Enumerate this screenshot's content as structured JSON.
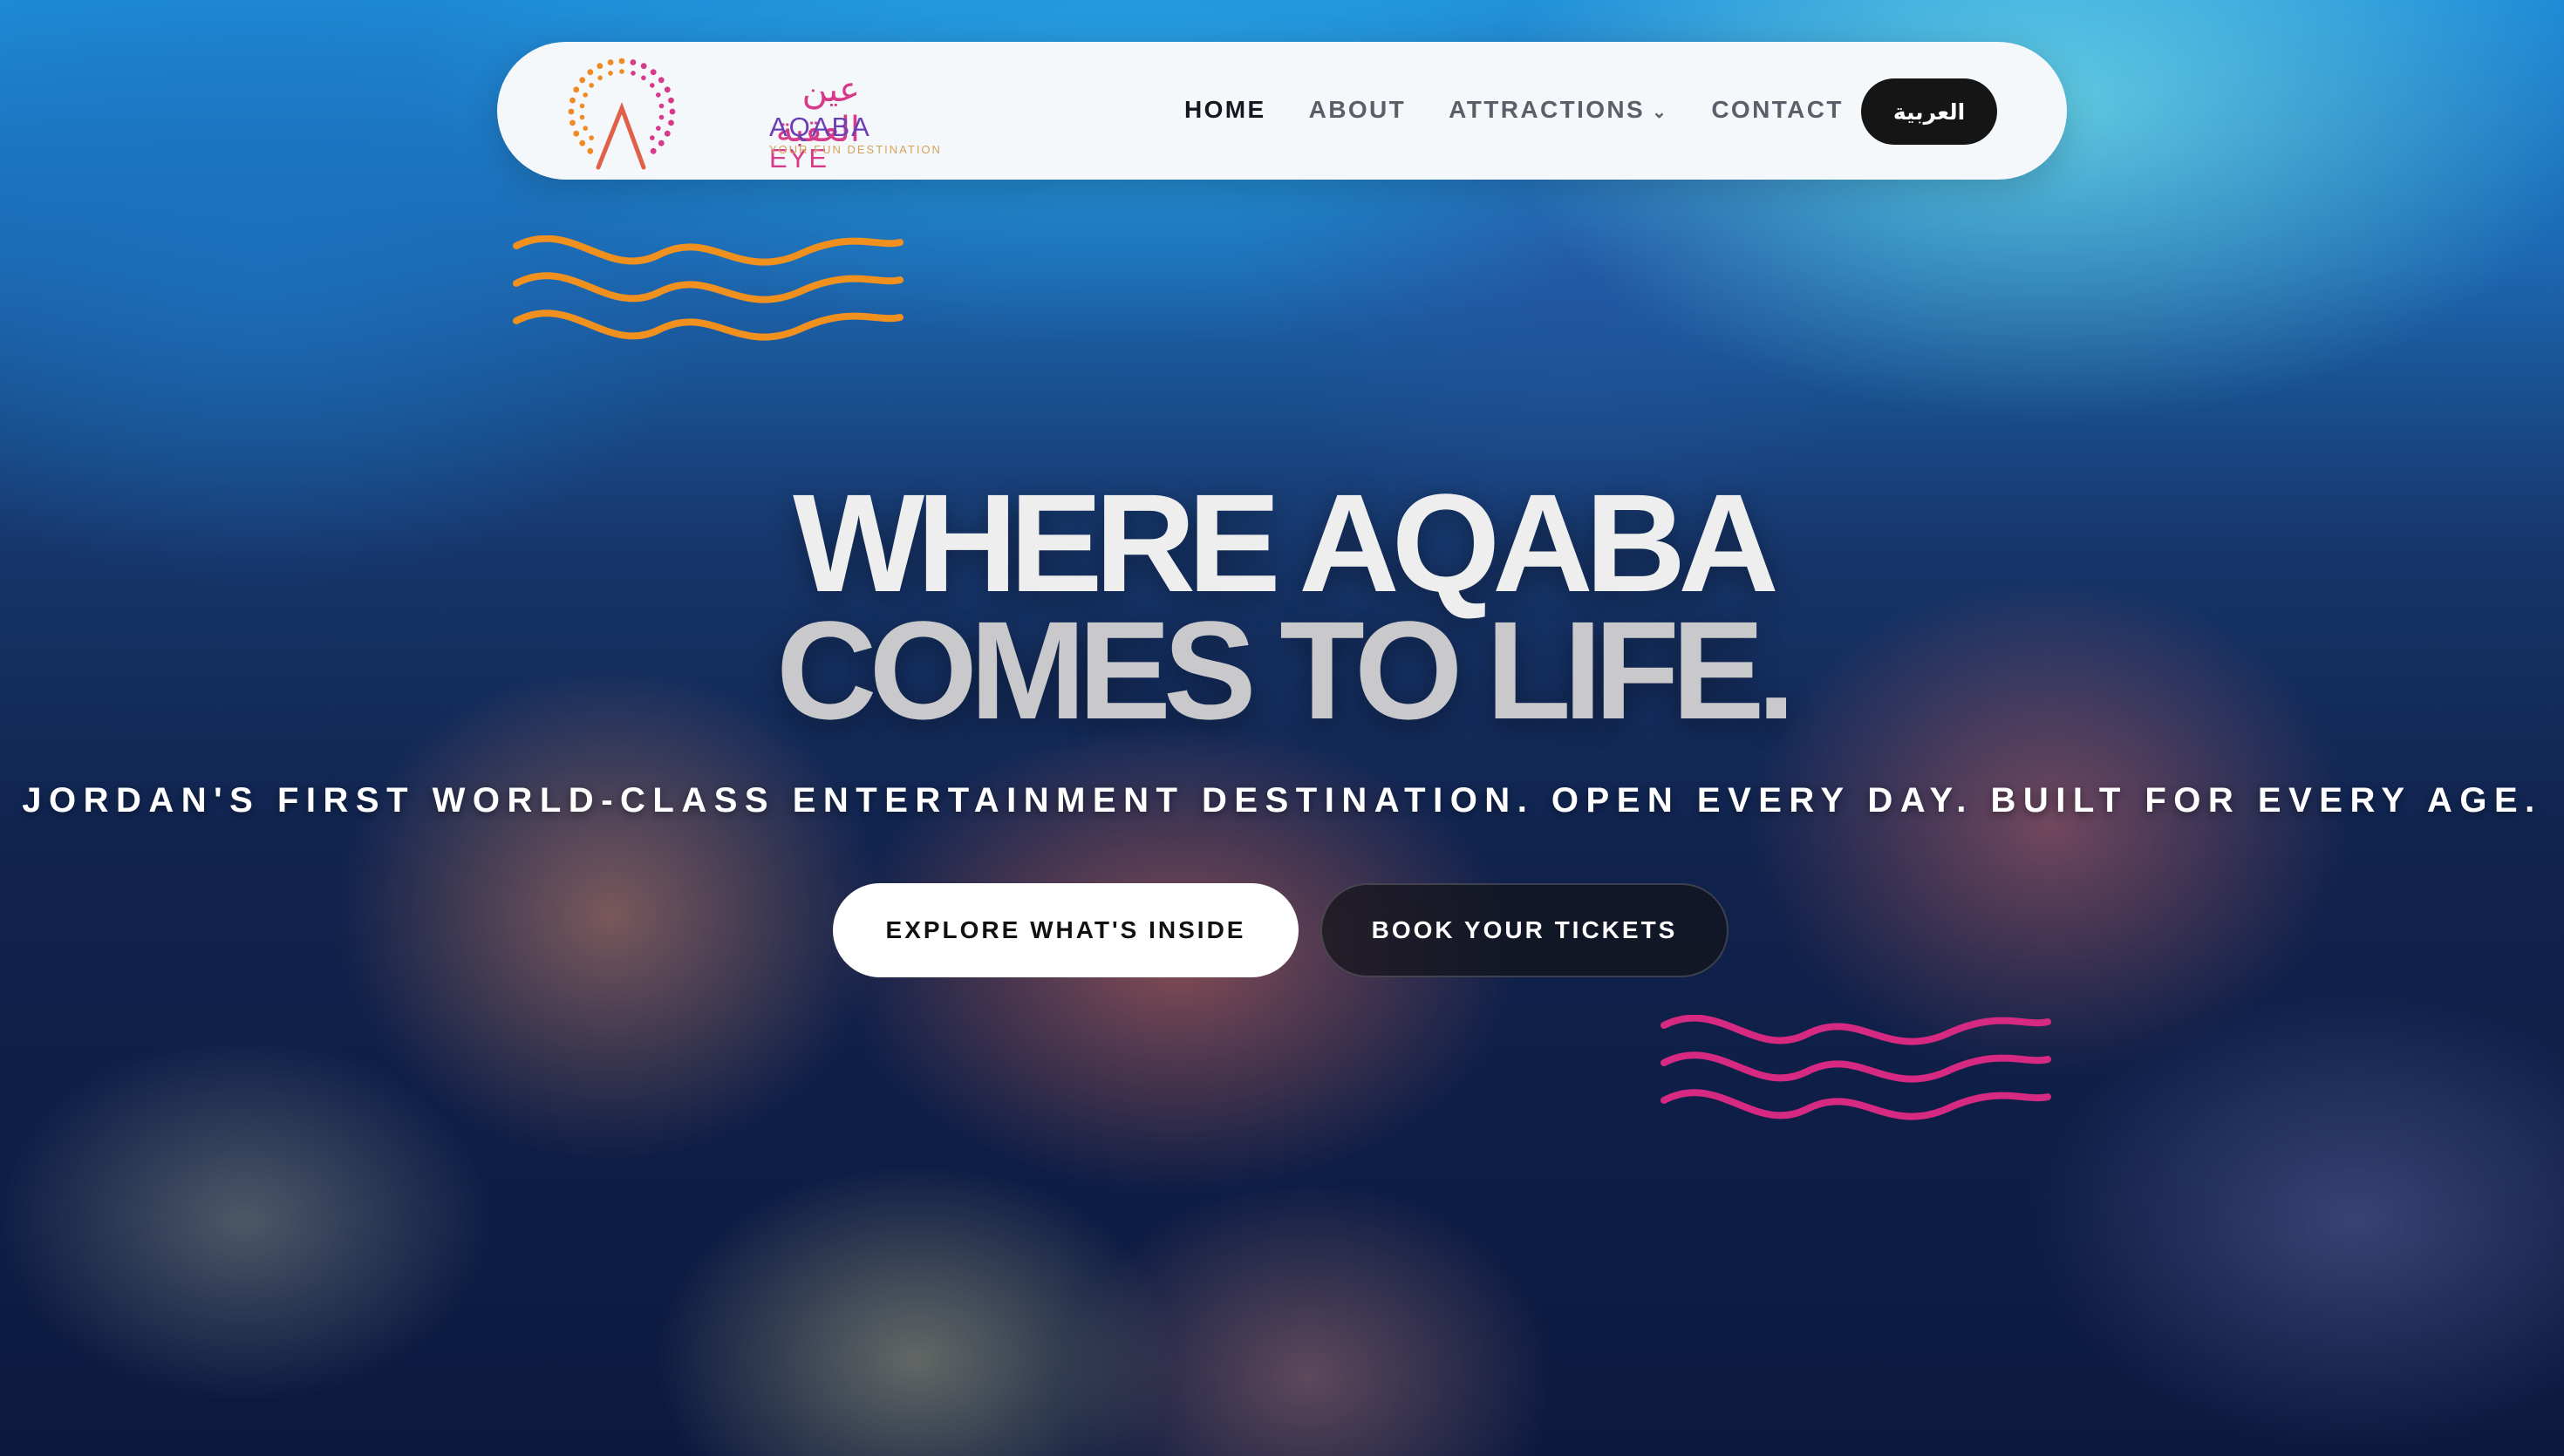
{
  "nav": {
    "logo": {
      "arabic": "عين العقبة",
      "name_part1": "AQABA",
      "name_part2": "EYE",
      "tagline": "YOUR FUN DESTINATION"
    },
    "items": [
      {
        "label": "HOME",
        "active": true
      },
      {
        "label": "ABOUT",
        "active": false
      },
      {
        "label": "ATTRACTIONS",
        "active": false,
        "has_dropdown": true
      },
      {
        "label": "CONTACT",
        "active": false
      }
    ],
    "language_button": "العربية"
  },
  "hero": {
    "headline_line1": "WHERE AQABA",
    "headline_line2": "COMES TO LIFE.",
    "tagline": "JORDAN'S FIRST WORLD-CLASS ENTERTAINMENT DESTINATION. OPEN EVERY DAY. BUILT FOR EVERY AGE.",
    "primary_button": "EXPLORE WHAT'S INSIDE",
    "secondary_button": "BOOK YOUR TICKETS"
  },
  "colors": {
    "wave_orange": "#f0901e",
    "wave_pink": "#d62a82",
    "logo_orange": "#f08a24",
    "logo_pink": "#d63a88",
    "nav_bg": "#f5f8fb",
    "lang_button_bg": "#151515"
  },
  "icons": {
    "dropdown": "chevron-down-icon",
    "logo_mark": "ferris-wheel-icon"
  }
}
